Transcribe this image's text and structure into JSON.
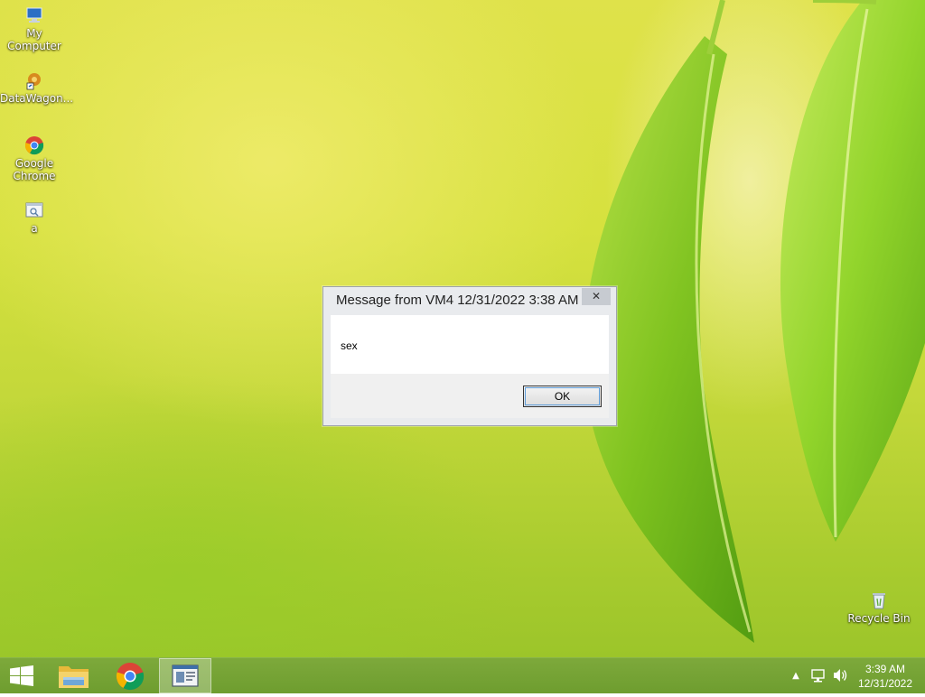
{
  "desktop": {
    "icons": [
      {
        "label": "My Computer",
        "icon": "computer-icon"
      },
      {
        "label": "DataWagon...",
        "icon": "datawagon-icon"
      },
      {
        "label": "Google Chrome",
        "icon": "chrome-icon"
      },
      {
        "label": "a",
        "icon": "document-icon"
      },
      {
        "label": "Recycle Bin",
        "icon": "recycle-bin-icon"
      }
    ]
  },
  "dialog": {
    "title": "Message from VM4 12/31/2022 3:38 AM",
    "close_glyph": "✕",
    "message": "sex",
    "ok_label": "OK"
  },
  "taskbar": {
    "items": [
      {
        "name": "start-button",
        "icon": "windows-logo-icon"
      },
      {
        "name": "file-explorer",
        "icon": "folder-icon"
      },
      {
        "name": "google-chrome",
        "icon": "chrome-icon"
      },
      {
        "name": "message-window",
        "icon": "window-icon",
        "active": true
      }
    ],
    "tray": {
      "chevron": "▲",
      "network_icon": "network-icon",
      "volume_icon": "speaker-icon"
    },
    "clock": {
      "time": "3:39 AM",
      "date": "12/31/2022"
    }
  },
  "colors": {
    "taskbar": "#6e9d2f",
    "wallpaper_base": "#d6e13e",
    "leaf_green": "#7cc21e"
  }
}
